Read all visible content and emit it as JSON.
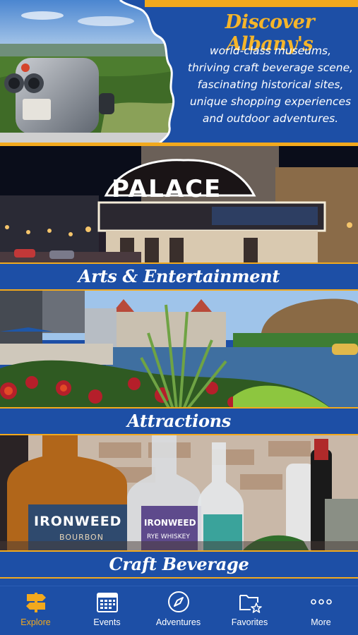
{
  "hero": {
    "headline": "Discover Albany's",
    "lines": [
      "world-class museums,",
      "thriving craft beverage scene,",
      "fascinating historical sites,",
      "unique shopping experiences",
      "and outdoor adventures."
    ]
  },
  "categories": [
    {
      "label": "Arts & Entertainment",
      "sign_text": "PALACE"
    },
    {
      "label": "Attractions"
    },
    {
      "label": "Craft Beverage",
      "bottle_brand": "IRONWEED",
      "bottle_1": "BOURBON",
      "bottle_2": "RYE WHISKEY"
    }
  ],
  "tabbar": {
    "active": "Explore",
    "tabs": [
      {
        "label": "Explore",
        "icon": "signpost-icon"
      },
      {
        "label": "Events",
        "icon": "calendar-icon"
      },
      {
        "label": "Adventures",
        "icon": "compass-icon"
      },
      {
        "label": "Favorites",
        "icon": "folder-star-icon"
      },
      {
        "label": "More",
        "icon": "more-dots-icon"
      }
    ]
  },
  "colors": {
    "brand_blue": "#1d4fa6",
    "accent_gold": "#f2a91d",
    "active_tab": "#f2a91d"
  }
}
